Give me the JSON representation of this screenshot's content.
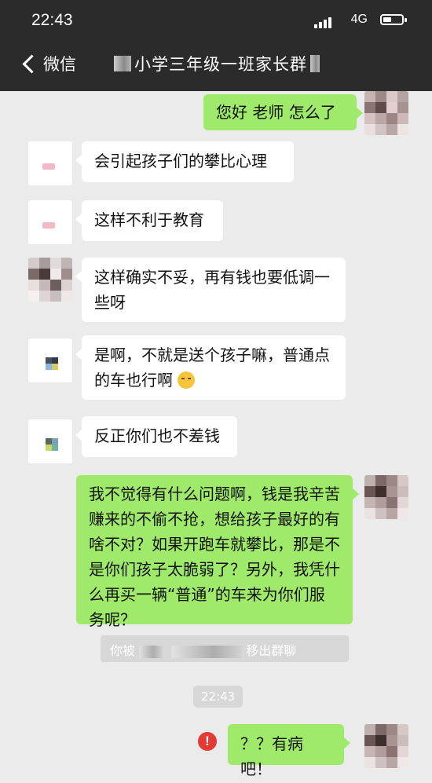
{
  "status_bar": {
    "time": "22:43",
    "network": "4G"
  },
  "nav": {
    "back_label": "微信",
    "title": "小学三年级一班家长群"
  },
  "messages": [
    {
      "side": "out",
      "text": "您好 老师 怎么了"
    },
    {
      "side": "in",
      "text": "会引起孩子们的攀比心理"
    },
    {
      "side": "in",
      "text": "这样不利于教育"
    },
    {
      "side": "in",
      "text": "这样确实不妥，再有钱也要低调一些呀"
    },
    {
      "side": "in",
      "text": "是啊，不就是送个孩子嘛，普通点的车也行啊"
    },
    {
      "side": "in",
      "text": "反正你们也不差钱"
    },
    {
      "side": "out",
      "text": "我不觉得有什么问题啊，钱是我辛苦赚来的不偷不抢，想给孩子最好的有啥不对？如果开跑车就攀比，那是不是你们孩子太脆弱了？另外，我凭什么再买一辆“普通”的车来为你们服务呢？"
    },
    {
      "side": "out",
      "text": "？？有病吧！"
    }
  ],
  "system_notice": {
    "prefix": "你被",
    "suffix": "移出群聊"
  },
  "timestamp": "22:43",
  "error_icon_text": "!",
  "icons": [
    "back-chevron-icon",
    "signal-icon",
    "battery-icon",
    "send-failed-icon",
    "emoji-icon"
  ]
}
